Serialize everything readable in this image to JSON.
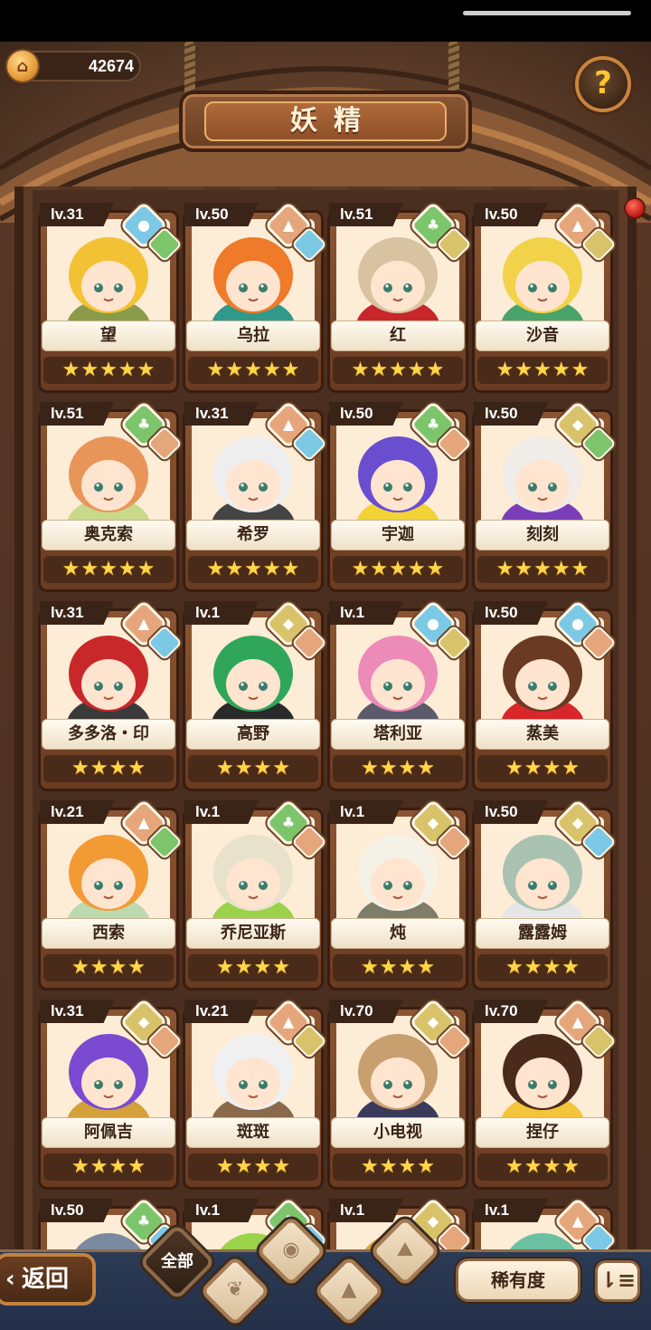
{
  "header": {
    "coins": "42674",
    "title": "妖精",
    "help_glyph": "?"
  },
  "element_colors": {
    "water": "#7cc9e6",
    "nature": "#7cc56b",
    "earth": "#e6a67c",
    "light": "#d9c36a"
  },
  "fairies": [
    {
      "level": "lv.31",
      "name": "望",
      "stars": 5,
      "elements": [
        "water",
        "nature"
      ],
      "hair": "#f2c234",
      "accent": "#8a9b4a"
    },
    {
      "level": "lv.50",
      "name": "乌拉",
      "stars": 5,
      "elements": [
        "earth",
        "water"
      ],
      "hair": "#ee7a2a",
      "accent": "#2f9a8a"
    },
    {
      "level": "lv.51",
      "name": "红",
      "stars": 5,
      "elements": [
        "nature",
        "light"
      ],
      "hair": "#d8c3a1",
      "accent": "#c7262a"
    },
    {
      "level": "lv.50",
      "name": "沙音",
      "stars": 5,
      "elements": [
        "earth",
        "light"
      ],
      "hair": "#f1d24a",
      "accent": "#4aa36a"
    },
    {
      "level": "lv.51",
      "name": "奥克索",
      "stars": 5,
      "elements": [
        "nature",
        "earth"
      ],
      "hair": "#e8955a",
      "accent": "#c8d98a"
    },
    {
      "level": "lv.31",
      "name": "希罗",
      "stars": 5,
      "elements": [
        "earth",
        "water"
      ],
      "hair": "#eeeeee",
      "accent": "#444444"
    },
    {
      "level": "lv.50",
      "name": "宇迦",
      "stars": 5,
      "elements": [
        "nature",
        "earth"
      ],
      "hair": "#6a4ed0",
      "accent": "#f2d234"
    },
    {
      "level": "lv.50",
      "name": "刻刻",
      "stars": 5,
      "elements": [
        "light",
        "nature"
      ],
      "hair": "#f0ece8",
      "accent": "#7a3fb8"
    },
    {
      "level": "lv.31",
      "name": "多多洛・印",
      "stars": 4,
      "elements": [
        "earth",
        "water"
      ],
      "hair": "#c8282a",
      "accent": "#3a3a3a"
    },
    {
      "level": "lv.1",
      "name": "高野",
      "stars": 4,
      "elements": [
        "light",
        "earth"
      ],
      "hair": "#2fa65a",
      "accent": "#2a2a2a"
    },
    {
      "level": "lv.1",
      "name": "塔利亚",
      "stars": 4,
      "elements": [
        "water",
        "light"
      ],
      "hair": "#ec8ab8",
      "accent": "#5a5a6a"
    },
    {
      "level": "lv.50",
      "name": "蒸美",
      "stars": 4,
      "elements": [
        "water",
        "earth"
      ],
      "hair": "#6a3a22",
      "accent": "#d8262a"
    },
    {
      "level": "lv.21",
      "name": "西索",
      "stars": 4,
      "elements": [
        "earth",
        "nature"
      ],
      "hair": "#f29a34",
      "accent": "#bcd9b0"
    },
    {
      "level": "lv.1",
      "name": "乔尼亚斯",
      "stars": 4,
      "elements": [
        "nature",
        "earth"
      ],
      "hair": "#e8e2cc",
      "accent": "#9ad24a"
    },
    {
      "level": "lv.1",
      "name": "炖",
      "stars": 4,
      "elements": [
        "light",
        "earth"
      ],
      "hair": "#f4f1e6",
      "accent": "#7d7d6a"
    },
    {
      "level": "lv.50",
      "name": "露露姆",
      "stars": 4,
      "elements": [
        "light",
        "water"
      ],
      "hair": "#a9c2b2",
      "accent": "#e6e6e6"
    },
    {
      "level": "lv.31",
      "name": "阿佩吉",
      "stars": 4,
      "elements": [
        "light",
        "earth"
      ],
      "hair": "#7a4ad0",
      "accent": "#d4a03a"
    },
    {
      "level": "lv.21",
      "name": "斑斑",
      "stars": 4,
      "elements": [
        "earth",
        "light"
      ],
      "hair": "#f0f0f0",
      "accent": "#8a6a4a"
    },
    {
      "level": "lv.70",
      "name": "小电视",
      "stars": 4,
      "elements": [
        "light",
        "earth"
      ],
      "hair": "#c8a070",
      "accent": "#3a3a5a"
    },
    {
      "level": "lv.70",
      "name": "捏仔",
      "stars": 4,
      "elements": [
        "earth",
        "light"
      ],
      "hair": "#4a2a1a",
      "accent": "#f4c43a"
    },
    {
      "level": "lv.50",
      "name": "",
      "stars": 0,
      "elements": [
        "nature",
        "water"
      ],
      "hair": "#7a8aa0",
      "accent": "#2a60c0"
    },
    {
      "level": "lv.1",
      "name": "",
      "stars": 0,
      "elements": [
        "nature",
        "water"
      ],
      "hair": "#9ad24a",
      "accent": "#7ac040"
    },
    {
      "level": "lv.1",
      "name": "",
      "stars": 0,
      "elements": [
        "light",
        "earth"
      ],
      "hair": "#d8a23a",
      "accent": "#5a3a22"
    },
    {
      "level": "lv.1",
      "name": "",
      "stars": 0,
      "elements": [
        "earth",
        "water"
      ],
      "hair": "#6ac0a0",
      "accent": "#5ad0b0"
    }
  ],
  "bottom_bar": {
    "back_label": "返回",
    "back_glyph": "‹",
    "filter_all_label": "全部",
    "rarity_label": "稀有度",
    "sort_glyph": "⇂≡"
  }
}
